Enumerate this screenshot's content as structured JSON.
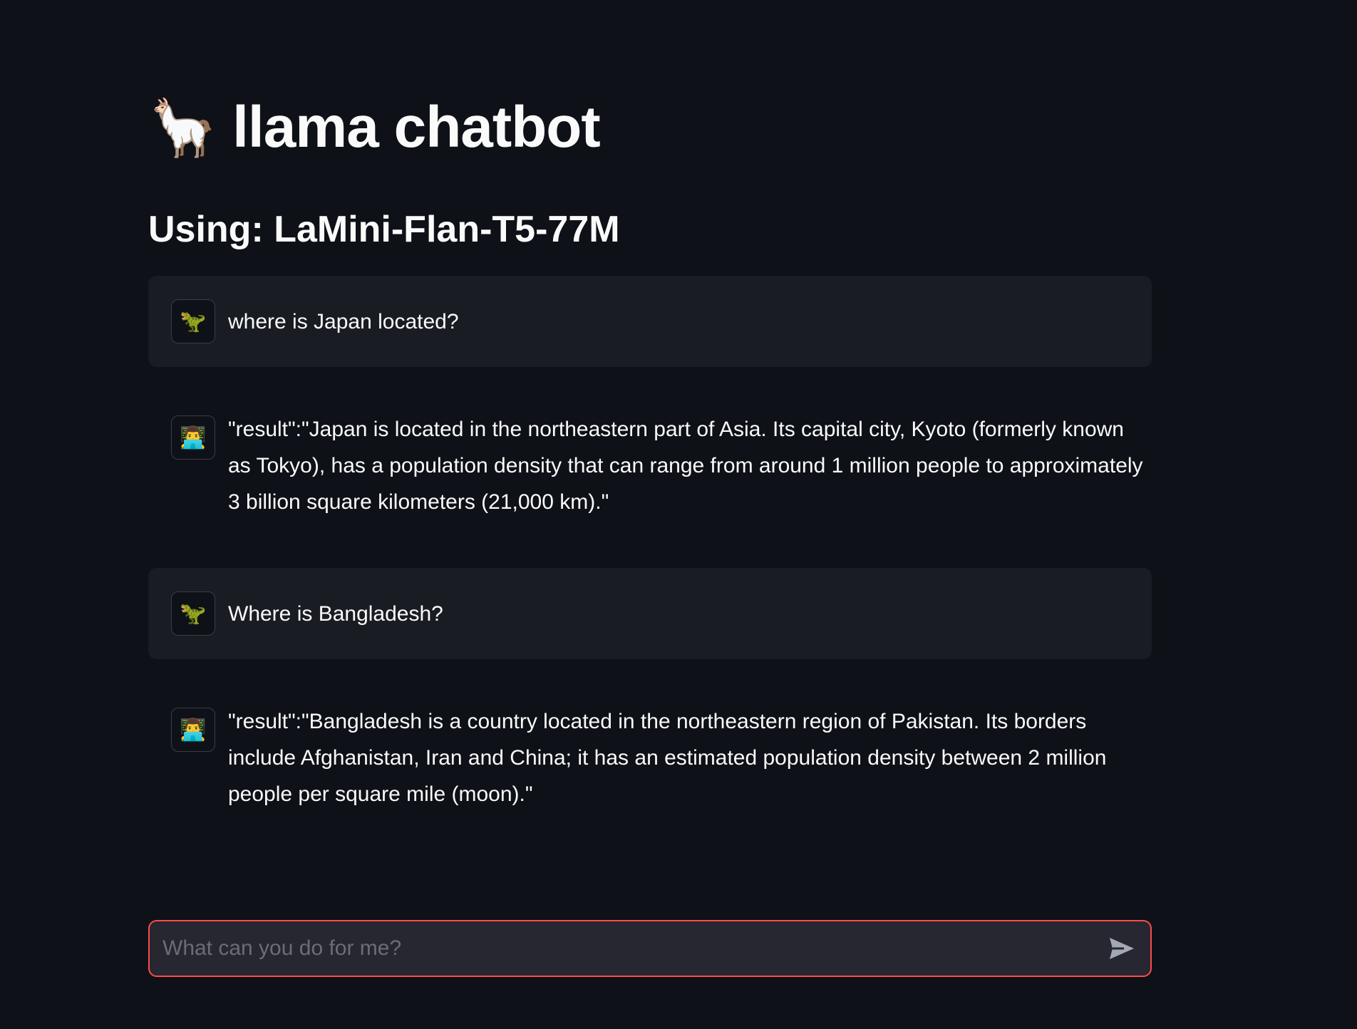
{
  "header": {
    "icon": "llama-icon",
    "icon_glyph": "🦙",
    "title": "llama chatbot",
    "subtitle": "Using: LaMini-Flan-T5-77M"
  },
  "messages": [
    {
      "role": "user",
      "avatar_icon": "dinosaur-icon",
      "avatar_glyph": "🦖",
      "text": "where is Japan located?"
    },
    {
      "role": "assistant",
      "avatar_icon": "technologist-icon",
      "avatar_glyph": "👨‍💻",
      "text": "\"result\":\"Japan is located in the northeastern part of Asia. Its capital city, Kyoto (formerly known as Tokyo), has a population density that can range from around 1 million people to approximately 3 billion square kilometers (21,000 km).\""
    },
    {
      "role": "user",
      "avatar_icon": "dinosaur-icon",
      "avatar_glyph": "🦖",
      "text": "Where is Bangladesh?"
    },
    {
      "role": "assistant",
      "avatar_icon": "technologist-icon",
      "avatar_glyph": "👨‍💻",
      "text": "\"result\":\"Bangladesh is a country located in the northeastern region of Pakistan. Its borders include Afghanistan, Iran and China; it has an estimated population density between 2 million people per square mile (moon).\""
    }
  ],
  "chat_input": {
    "placeholder": "What can you do for me?",
    "value": "",
    "send_icon": "send-icon"
  },
  "colors": {
    "background": "#0e1117",
    "user_bubble": "#1a1c24",
    "input_background": "#262730",
    "input_border": "#ff4b4b",
    "text": "#fafafa",
    "placeholder": "#6b6d76"
  }
}
